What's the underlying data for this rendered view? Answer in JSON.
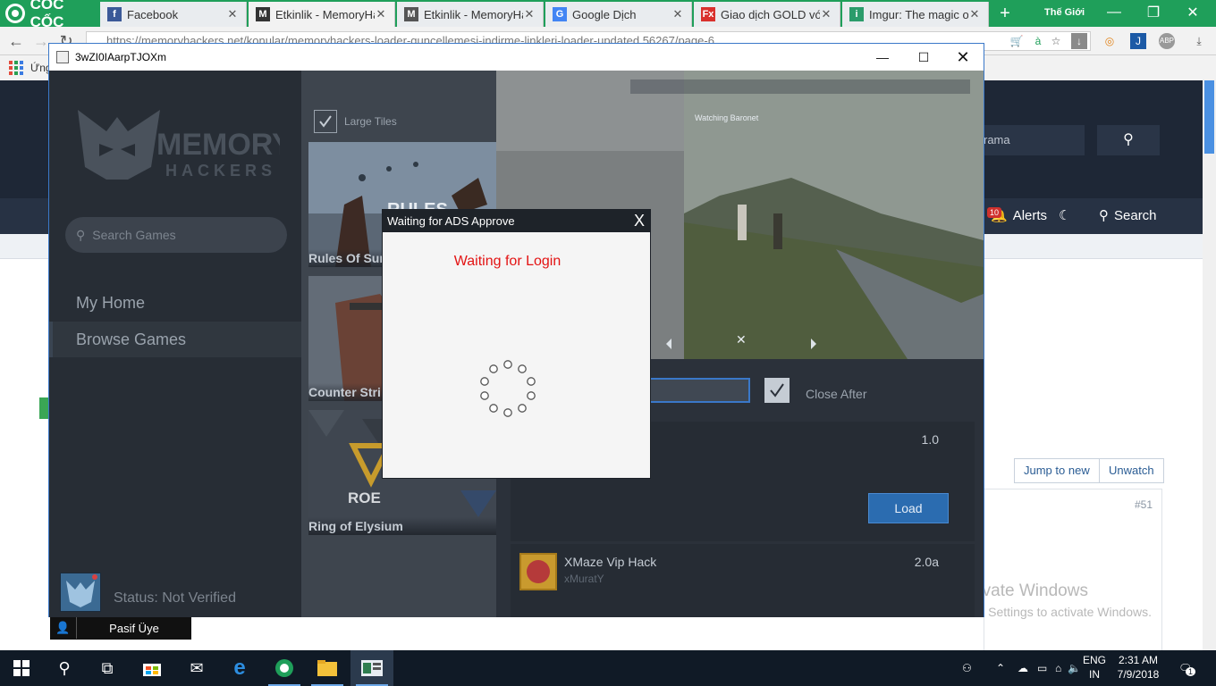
{
  "browser": {
    "brand": "CỐC CỐC",
    "tabs": [
      {
        "label": "Facebook",
        "icon": "facebook-icon",
        "active": false
      },
      {
        "label": "Etkinlik - MemoryHac",
        "icon": "memoryhackers-icon",
        "active": true
      },
      {
        "label": "Etkinlik - MemoryHac",
        "icon": "memoryhackers-icon",
        "active": false
      },
      {
        "label": "Google Dịch",
        "icon": "google-translate-icon",
        "active": false
      },
      {
        "label": "Giao dịch GOLD với F",
        "icon": "fx-icon",
        "active": false
      },
      {
        "label": "Imgur: The magic of",
        "icon": "imgur-icon",
        "active": false
      }
    ],
    "window_label": "Thế Giới",
    "url": "https://memoryhackers.net/konular/memoryhackers-loader-guncellemesi-indirme-linkleri-loader-updated.56267/page-6",
    "bookmarks_label": "Ứng"
  },
  "site": {
    "search_placeholder": "rama",
    "nav": {
      "alerts_label": "Alerts",
      "alerts_count": "10",
      "search_label": "Search"
    },
    "jump_to_new": "Jump to new",
    "unwatch": "Unwatch",
    "post_number": "#51",
    "user_role": "Pasif Üye",
    "activate_title": "Activate Windows",
    "activate_sub": "Go to Settings to activate Windows."
  },
  "app": {
    "title": "3wZI0IAarpTJOXm",
    "search_placeholder": "Search Games",
    "menu": [
      {
        "label": "My Home",
        "active": false
      },
      {
        "label": "Browse Games",
        "active": true
      }
    ],
    "status": "Status: Not Verified",
    "large_tiles_label": "Large Tiles",
    "large_tiles_checked": true,
    "tiles": [
      {
        "name": "Rules Of Sur"
      },
      {
        "name": "Counter Stri"
      },
      {
        "name": "Ring of Elysium"
      }
    ],
    "close_after_label": "Close After",
    "close_after_checked": true,
    "cards": [
      {
        "version": "1.0",
        "button": "Load"
      },
      {
        "name": "XMaze Vip Hack",
        "author": "xMuratY",
        "version": "2.0a"
      }
    ]
  },
  "modal": {
    "title": "Waiting for ADS Approve",
    "close": "X",
    "message": "Waiting for Login",
    "message_color": "#e31313"
  },
  "taskbar": {
    "lang_top": "ENG",
    "lang_bottom": "IN",
    "time": "2:31 AM",
    "date": "7/9/2018",
    "notification_count": "1"
  }
}
